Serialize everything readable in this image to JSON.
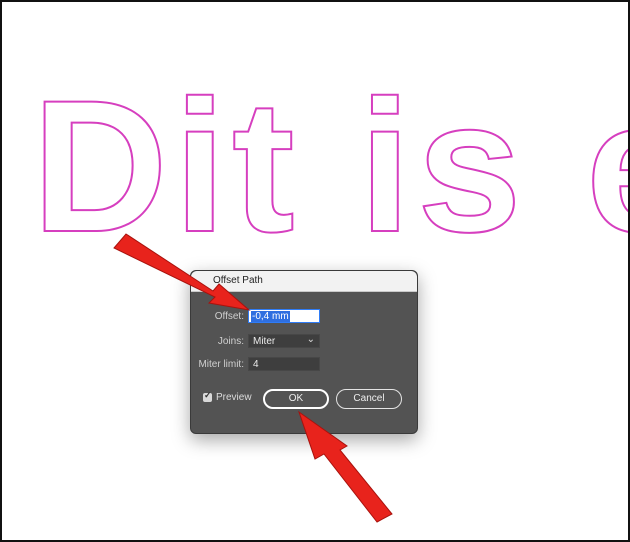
{
  "canvas": {
    "text": "Dit is e",
    "stroke_color": "#d63fbf"
  },
  "dialog": {
    "title": "Offset Path",
    "offset_label": "Offset:",
    "offset_value": "-0,4 mm",
    "joins_label": "Joins:",
    "joins_value": "Miter",
    "miter_label": "Miter limit:",
    "miter_value": "4",
    "preview_label": "Preview",
    "preview_checked": true,
    "ok_label": "OK",
    "cancel_label": "Cancel"
  },
  "annotations": {
    "arrow_color": "#e8231c"
  },
  "colors": {
    "dialog_bg": "#535353",
    "selection": "#2f6fe0"
  }
}
